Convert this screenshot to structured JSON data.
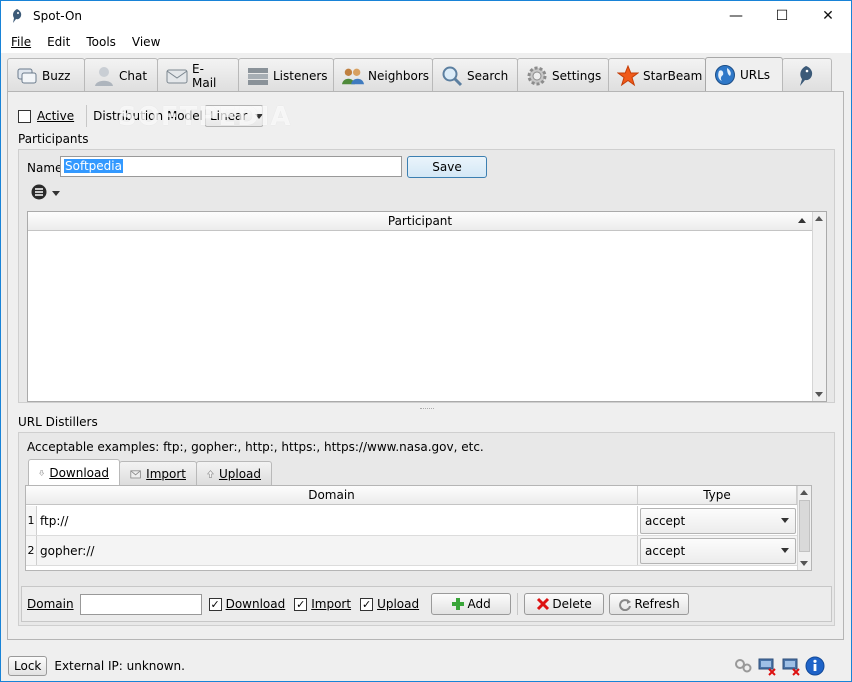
{
  "window": {
    "title": "Spot-On",
    "minimize": "—",
    "maximize": "☐",
    "close": "✕"
  },
  "menu": {
    "file": "File",
    "edit": "Edit",
    "tools": "Tools",
    "view": "View"
  },
  "tabs": [
    {
      "label": "Buzz",
      "icon": "buzz-icon"
    },
    {
      "label": "Chat",
      "icon": "chat-icon"
    },
    {
      "label": "E-Mail",
      "icon": "email-icon"
    },
    {
      "label": "Listeners",
      "icon": "listeners-icon"
    },
    {
      "label": "Neighbors",
      "icon": "neighbors-icon"
    },
    {
      "label": "Search",
      "icon": "search-icon"
    },
    {
      "label": "Settings",
      "icon": "settings-icon"
    },
    {
      "label": "StarBeam",
      "icon": "starbeam-icon"
    },
    {
      "label": "URLs",
      "icon": "globe-icon",
      "active": true
    },
    {
      "label": "",
      "icon": "spot-on-icon"
    }
  ],
  "top": {
    "active_label": "Active",
    "distribution_label": "Distribution Model",
    "distribution_value": "Linear"
  },
  "participants": {
    "section_label": "Participants",
    "name_label": "Name",
    "name_value": "Softpedia",
    "save_label": "Save",
    "column_header": "Participant"
  },
  "distillers": {
    "section_label": "URL Distillers",
    "examples_text": "Acceptable examples: ftp:, gopher:, http:, https:, https://www.nasa.gov, etc.",
    "subtabs": {
      "download": "Download",
      "import": "Import",
      "upload": "Upload"
    },
    "columns": {
      "domain": "Domain",
      "type": "Type"
    },
    "rows": [
      {
        "num": "1",
        "domain": "ftp://",
        "type": "accept"
      },
      {
        "num": "2",
        "domain": "gopher://",
        "type": "accept"
      }
    ],
    "bottom": {
      "domain_label": "Domain",
      "domain_value": "",
      "download_label": "Download",
      "import_label": "Import",
      "upload_label": "Upload",
      "add_label": "Add",
      "delete_label": "Delete",
      "refresh_label": "Refresh"
    }
  },
  "status": {
    "lock_label": "Lock",
    "external_ip": "External IP: unknown."
  },
  "watermark": "SOFTPEDIA",
  "colors": {
    "accent": "#1883d7",
    "selection": "#3399ff"
  }
}
